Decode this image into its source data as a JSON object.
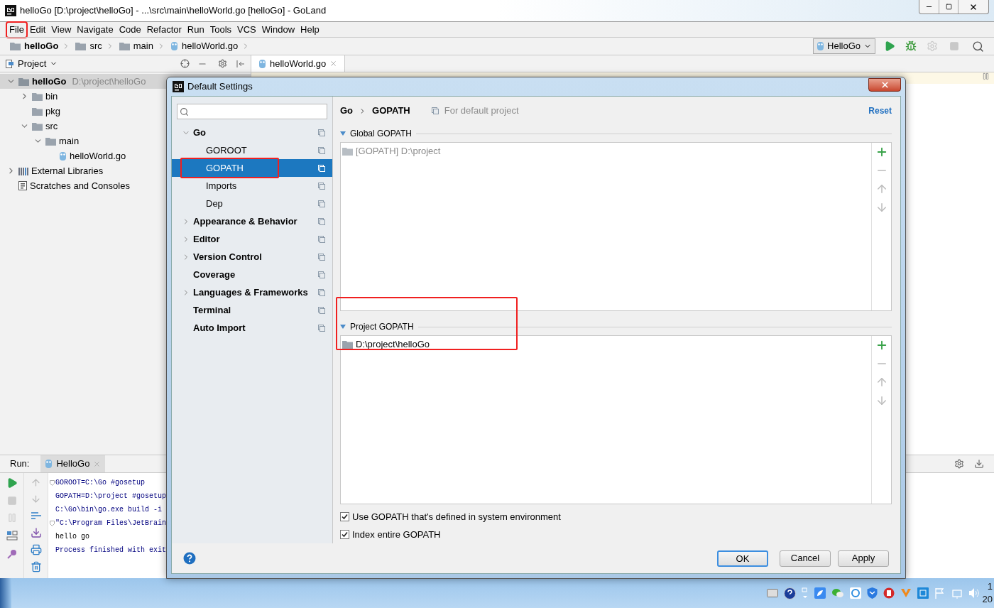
{
  "window": {
    "title": "helloGo [D:\\project\\helloGo] - ...\\src\\main\\helloWorld.go [helloGo] - GoLand"
  },
  "menu": [
    {
      "label": "File",
      "annotated": true
    },
    {
      "label": "Edit",
      "annotated": false
    },
    {
      "label": "View",
      "annotated": false
    },
    {
      "label": "Navigate",
      "annotated": false
    },
    {
      "label": "Code",
      "annotated": false
    },
    {
      "label": "Refactor",
      "annotated": false
    },
    {
      "label": "Run",
      "annotated": false
    },
    {
      "label": "Tools",
      "annotated": false
    },
    {
      "label": "VCS",
      "annotated": false
    },
    {
      "label": "Window",
      "annotated": false
    },
    {
      "label": "Help",
      "annotated": false
    }
  ],
  "breadcrumbs": [
    {
      "label": "helloGo",
      "kind": "project"
    },
    {
      "label": "src",
      "kind": "folder"
    },
    {
      "label": "main",
      "kind": "folder"
    },
    {
      "label": "helloWorld.go",
      "kind": "file"
    }
  ],
  "run_config": {
    "label": "HelloGo"
  },
  "project_panel": {
    "title": "Project",
    "tree": [
      {
        "label": "helloGo",
        "path": "D:\\project\\helloGo",
        "kind": "project",
        "expanded": true,
        "selected": true,
        "children": [
          {
            "label": "bin",
            "kind": "folder",
            "expanded": false,
            "selected": false
          },
          {
            "label": "pkg",
            "kind": "folder",
            "selected": false
          },
          {
            "label": "src",
            "kind": "folder",
            "expanded": true,
            "selected": false,
            "children": [
              {
                "label": "main",
                "kind": "folder",
                "expanded": true,
                "selected": false,
                "children": [
                  {
                    "label": "helloWorld.go",
                    "kind": "file",
                    "selected": false
                  }
                ]
              }
            ]
          }
        ]
      },
      {
        "label": "External Libraries",
        "kind": "library",
        "expanded": false,
        "selected": false
      },
      {
        "label": "Scratches and Consoles",
        "kind": "scratches",
        "selected": false
      }
    ]
  },
  "editor": {
    "tabs": [
      {
        "label": "helloWorld.go",
        "selected": true
      }
    ]
  },
  "run_panel": {
    "label": "Run:",
    "tabs": [
      {
        "label": "HelloGo",
        "selected": true
      }
    ],
    "lines": [
      {
        "text": "GOROOT=C:\\Go #gosetup",
        "kind": "system",
        "fold": true
      },
      {
        "text": "GOPATH=D:\\project #gosetup",
        "kind": "system",
        "fold": false
      },
      {
        "text": "C:\\Go\\bin\\go.exe build -i",
        "kind": "system",
        "fold": false
      },
      {
        "text": "\"C:\\Program Files\\JetBrain",
        "kind": "system",
        "fold": true
      },
      {
        "text": "hello go",
        "kind": "output",
        "fold": false
      },
      {
        "text": "Process finished with exit",
        "kind": "system",
        "fold": false
      }
    ]
  },
  "dialog": {
    "title": "Default Settings",
    "tree": [
      {
        "label": "Go",
        "kind": "group",
        "expanded": true,
        "selected": false,
        "annotated": false,
        "children": [
          {
            "label": "GOROOT",
            "kind": "page",
            "selected": false,
            "annotated": false
          },
          {
            "label": "GOPATH",
            "kind": "page",
            "selected": true,
            "annotated": true
          },
          {
            "label": "Imports",
            "kind": "page",
            "selected": false,
            "annotated": false
          },
          {
            "label": "Dep",
            "kind": "page",
            "selected": false,
            "annotated": false
          }
        ]
      },
      {
        "label": "Appearance & Behavior",
        "kind": "group",
        "expanded": false,
        "selected": false,
        "annotated": false
      },
      {
        "label": "Editor",
        "kind": "group",
        "expanded": false,
        "selected": false,
        "annotated": false
      },
      {
        "label": "Version Control",
        "kind": "group",
        "expanded": false,
        "selected": false,
        "annotated": false
      },
      {
        "label": "Coverage",
        "kind": "page",
        "selected": false,
        "annotated": false
      },
      {
        "label": "Languages & Frameworks",
        "kind": "group",
        "expanded": false,
        "selected": false,
        "annotated": false
      },
      {
        "label": "Terminal",
        "kind": "page",
        "selected": false,
        "annotated": false
      },
      {
        "label": "Auto Import",
        "kind": "page",
        "selected": false,
        "annotated": false
      }
    ],
    "path": [
      "Go",
      "GOPATH"
    ],
    "scope": "For default project",
    "reset": "Reset",
    "sections": [
      {
        "title": "Global GOPATH",
        "annotated": false,
        "entries": [
          {
            "label": "[GOPATH] D:\\project",
            "inherited": true
          }
        ]
      },
      {
        "title": "Project GOPATH",
        "annotated": true,
        "entries": [
          {
            "label": "D:\\project\\helloGo",
            "inherited": false
          }
        ]
      }
    ],
    "checkboxes": [
      {
        "label": "Use GOPATH that's defined in system environment",
        "checked": true
      },
      {
        "label": "Index entire GOPATH",
        "checked": true
      }
    ],
    "buttons": [
      {
        "label": "OK",
        "default": true
      },
      {
        "label": "Cancel",
        "default": false
      },
      {
        "label": "Apply",
        "default": false
      }
    ]
  },
  "taskbar": {
    "clock": [
      "1",
      "20"
    ]
  }
}
